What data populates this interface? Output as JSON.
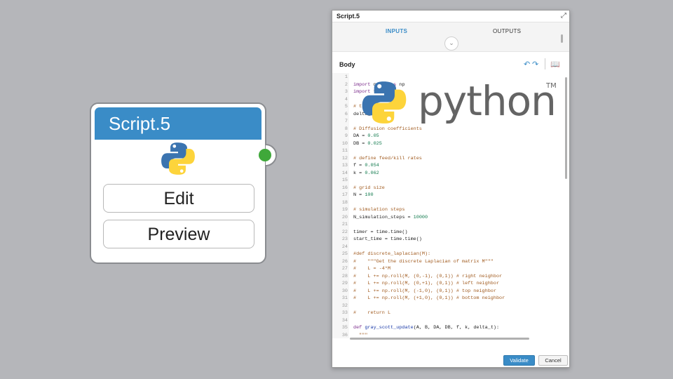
{
  "node": {
    "title": "Script.5",
    "edit_label": "Edit",
    "preview_label": "Preview",
    "port_color": "#3fa83a",
    "header_color": "#3a8cc7"
  },
  "dialog": {
    "title": "Script.5",
    "tabs": [
      {
        "label": "INPUTS",
        "active": true
      },
      {
        "label": "OUTPUTS",
        "active": false
      }
    ],
    "body_label": "Body",
    "validate_label": "Validate",
    "cancel_label": "Cancel",
    "accent_color": "#3a8cc7"
  },
  "logo": {
    "word": "python",
    "tm": "TM"
  },
  "code_lines": [
    {
      "n": "1",
      "t": ""
    },
    {
      "n": "2",
      "t": "import numpy as np"
    },
    {
      "n": "3",
      "t": "import time"
    },
    {
      "n": "4",
      "t": ""
    },
    {
      "n": "5",
      "t": "# time step"
    },
    {
      "n": "6",
      "t": "delta_t = 1.0"
    },
    {
      "n": "7",
      "t": ""
    },
    {
      "n": "8",
      "t": "# Diffusion coefficients"
    },
    {
      "n": "9",
      "t": "DA = 0.05"
    },
    {
      "n": "10",
      "t": "DB = 0.025"
    },
    {
      "n": "11",
      "t": ""
    },
    {
      "n": "12",
      "t": "# define feed/kill rates"
    },
    {
      "n": "13",
      "t": "f = 0.054"
    },
    {
      "n": "14",
      "t": "k = 0.062"
    },
    {
      "n": "15",
      "t": ""
    },
    {
      "n": "16",
      "t": "# grid size"
    },
    {
      "n": "17",
      "t": "N = 100"
    },
    {
      "n": "18",
      "t": ""
    },
    {
      "n": "19",
      "t": "# simulation steps"
    },
    {
      "n": "20",
      "t": "N_simulation_steps = 10000"
    },
    {
      "n": "21",
      "t": ""
    },
    {
      "n": "22",
      "t": "timer = time.time()"
    },
    {
      "n": "23",
      "t": "start_time = time.time()"
    },
    {
      "n": "24",
      "t": ""
    },
    {
      "n": "25",
      "t": "#def discrete_laplacian(M):"
    },
    {
      "n": "26",
      "t": "#    \"\"\"Get the discrete Laplacian of matrix M\"\"\""
    },
    {
      "n": "27",
      "t": "#    L = -4*M"
    },
    {
      "n": "28",
      "t": "#    L += np.roll(M, (0,-1), (0,1)) # right neighbor"
    },
    {
      "n": "29",
      "t": "#    L += np.roll(M, (0,+1), (0,1)) # left neighbor"
    },
    {
      "n": "30",
      "t": "#    L += np.roll(M, (-1,0), (0,1)) # top neighbor"
    },
    {
      "n": "31",
      "t": "#    L += np.roll(M, (+1,0), (0,1)) # bottom neighbor"
    },
    {
      "n": "32",
      "t": ""
    },
    {
      "n": "33",
      "t": "#    return L"
    },
    {
      "n": "34",
      "t": ""
    },
    {
      "n": "35",
      "t": "def gray_scott_update(A, B, DA, DB, f, k, delta_t):"
    },
    {
      "n": "36",
      "t": "  \"\"\""
    }
  ]
}
